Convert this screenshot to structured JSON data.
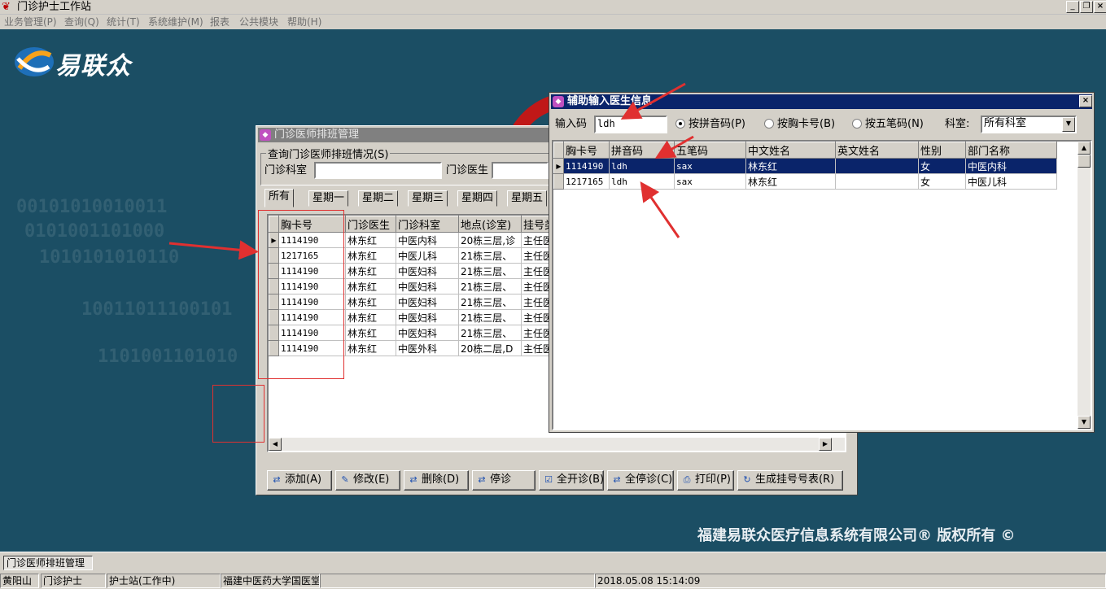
{
  "app": {
    "title": "门诊护士工作站",
    "icon": "app-logo-icon"
  },
  "window_controls": {
    "minimize": "_",
    "restore": "❐",
    "close": "×"
  },
  "menu": [
    "业务管理(P)",
    "查询(Q)",
    "统计(T)",
    "系统维护(M)",
    "报表",
    "公共模块",
    "帮助(H)"
  ],
  "desktop": {
    "logo_text": "易联众",
    "copyright": "福建易联众医疗信息系统有限公司® 版权所有 ©",
    "binary_bg": [
      "00101010010011",
      "0101001101000",
      "1010101010110",
      "10011011100101",
      "1101001101010"
    ]
  },
  "schedule_window": {
    "title": "门诊医师排班管理",
    "group_label": "查询门诊医师排班情况(S)",
    "dept_label": "门诊科室",
    "dept_value": "",
    "doctor_label": "门诊医生",
    "doctor_value": "",
    "tabs": [
      "所有",
      "星期一",
      "星期二",
      "星期三",
      "星期四",
      "星期五"
    ],
    "active_tab": "所有",
    "columns": [
      "胸卡号",
      "门诊医生",
      "门诊科室",
      "地点(诊室)",
      "挂号类"
    ],
    "rows": [
      [
        "1114190",
        "林东红",
        "中医内科",
        "20栋三层,诊",
        "主任医"
      ],
      [
        "1217165",
        "林东红",
        "中医儿科",
        "21栋三层、",
        "主任医"
      ],
      [
        "1114190",
        "林东红",
        "中医妇科",
        "21栋三层、",
        "主任医"
      ],
      [
        "1114190",
        "林东红",
        "中医妇科",
        "21栋三层、",
        "主任医"
      ],
      [
        "1114190",
        "林东红",
        "中医妇科",
        "21栋三层、",
        "主任医"
      ],
      [
        "1114190",
        "林东红",
        "中医妇科",
        "21栋三层、",
        "主任医"
      ],
      [
        "1114190",
        "林东红",
        "中医妇科",
        "21栋三层、",
        "主任医"
      ],
      [
        "1114190",
        "林东红",
        "中医外科",
        "20栋二层,D",
        "主任医"
      ]
    ],
    "buttons": [
      {
        "label": "添加(A)",
        "icon": "add-icon"
      },
      {
        "label": "修改(E)",
        "icon": "edit-icon"
      },
      {
        "label": "删除(D)",
        "icon": "delete-icon"
      },
      {
        "label": "停诊",
        "icon": "stop-icon"
      },
      {
        "label": "全开诊(B)",
        "icon": "open-all-icon"
      },
      {
        "label": "全停诊(C)",
        "icon": "stop-all-icon"
      },
      {
        "label": "打印(P)",
        "icon": "print-icon"
      },
      {
        "label": "生成挂号号表(R)",
        "icon": "refresh-icon"
      }
    ]
  },
  "assist_window": {
    "title": "辅助输入医生信息",
    "input_label": "输入码",
    "input_value": "ldh",
    "radios": [
      {
        "label": "按拼音码(P)",
        "checked": true
      },
      {
        "label": "按胸卡号(B)",
        "checked": false
      },
      {
        "label": "按五笔码(N)",
        "checked": false
      }
    ],
    "dept_label": "科室:",
    "dept_value": "所有科室",
    "columns": [
      "胸卡号",
      "拼音码",
      "五笔码",
      "中文姓名",
      "英文姓名",
      "性别",
      "部门名称"
    ],
    "rows": [
      [
        "1114190",
        "ldh",
        "sax",
        "林东红",
        "",
        "女",
        "中医内科"
      ],
      [
        "1217165",
        "ldh",
        "sax",
        "林东红",
        "",
        "女",
        "中医儿科"
      ]
    ],
    "selected_row": 0
  },
  "taskbar": {
    "item": "门诊医师排班管理"
  },
  "statusbar": [
    "黄阳山",
    "门诊护士",
    "护士站(工作中)",
    "福建中医药大学国医堂",
    "",
    "2018.05.08 15:14:09"
  ],
  "colors": {
    "desktop": "#1b4e64",
    "active_caption": "#0a246a",
    "inactive_caption": "#808080",
    "annotation": "#e03030"
  }
}
